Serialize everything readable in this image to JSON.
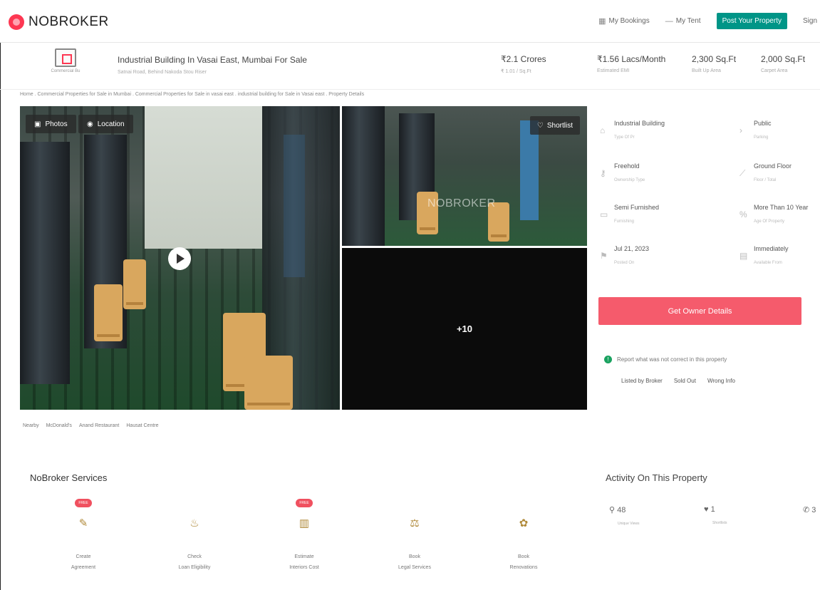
{
  "header": {
    "logo_text": "NOBROKER",
    "nav": {
      "bookings": "My Bookings",
      "menu": "My Tent",
      "post_property": "Post Your Property",
      "sign_in": "Sign"
    }
  },
  "listing": {
    "category_label": "Commercial Bu",
    "title": "Industrial Building In Vasai East, Mumbai For Sale",
    "subtitle": "Satnai Road, Behind Nakoda Stou Riser",
    "stats": [
      {
        "value": "₹2.1 Crores",
        "label": "₹ 1.01 / Sq.Ft"
      },
      {
        "value": "₹1.56 Lacs/Month",
        "label": "Estimated EMI"
      },
      {
        "value": "2,300 Sq.Ft",
        "label": "Built Up Area"
      },
      {
        "value": "2,000 Sq.Ft",
        "label": "Carpet Area"
      }
    ],
    "breadcrumb": "Home . Commercial Properties for Sale in Mumbai . Commercial Properties for Sale in vasai east . industrial building for Sale in Vasai east . Property Details"
  },
  "gallery": {
    "photos_label": "Photos",
    "location_label": "Location",
    "shortlist_label": "Shortlist",
    "watermark": "NOBROKER",
    "more_count": "+10"
  },
  "nearby": {
    "label": "Nearby",
    "items": [
      "McDonald's",
      "Anand Restaurant",
      "Hausat Centre"
    ]
  },
  "details": [
    {
      "value": "Industrial Building",
      "label": "Type Of Pr"
    },
    {
      "value": "Public",
      "label": "Parking"
    },
    {
      "value": "Freehold",
      "label": "Ownership Type"
    },
    {
      "value": "Ground Floor",
      "label": "Floor / Total"
    },
    {
      "value": "Semi Furnished",
      "label": "Furnishing"
    },
    {
      "value": "More Than 10 Year",
      "label": "Age Of Property"
    },
    {
      "value": "Jul 21, 2023",
      "label": "Posted On"
    },
    {
      "value": "Immediately",
      "label": "Available From"
    }
  ],
  "actions": {
    "get_owner": "Get Owner Details",
    "report_text": "Report what was not correct in this property",
    "report_links": [
      "Listed by Broker",
      "Sold Out",
      "Wrong Info"
    ]
  },
  "services": {
    "title": "NoBroker Services",
    "badge": "FREE",
    "items": [
      {
        "line1": "Create",
        "line2": "Agreement"
      },
      {
        "line1": "Check",
        "line2": "Loan Eligibility"
      },
      {
        "line1": "Estimate",
        "line2": "Interiors Cost"
      },
      {
        "line1": "Book",
        "line2": "Legal Services"
      },
      {
        "line1": "Book",
        "line2": "Renovations"
      }
    ]
  },
  "activity": {
    "title": "Activity On This Property",
    "views": "48",
    "views_label": "Unique Views",
    "shortlists": "1",
    "shortlists_label": "Shortlists",
    "contacts": "3"
  }
}
